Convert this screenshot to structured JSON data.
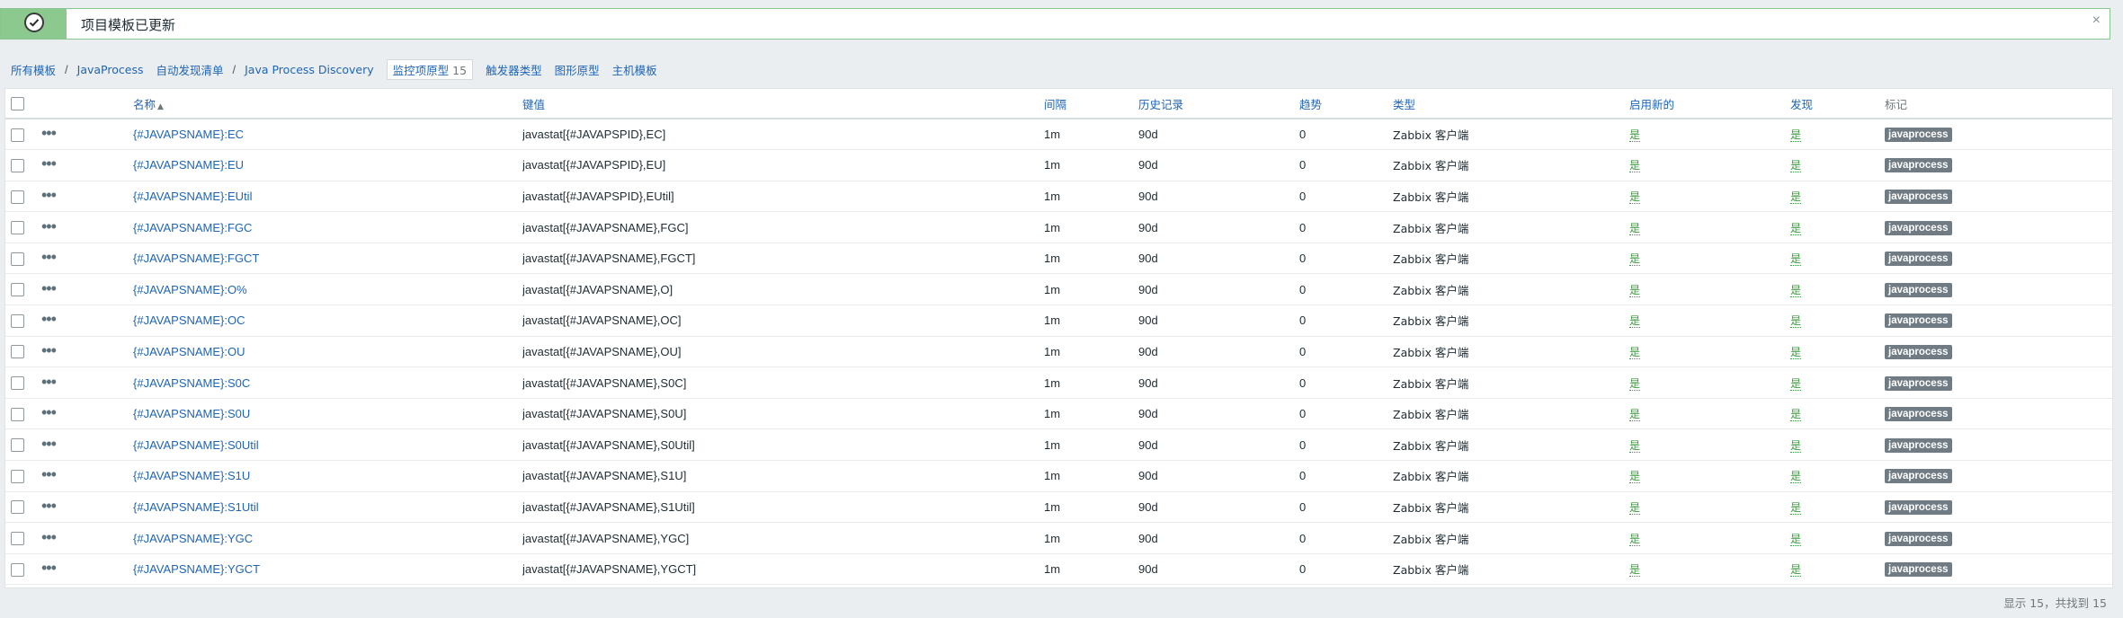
{
  "message": {
    "text": "项目模板已更新",
    "close": "×"
  },
  "nav": {
    "crumbs": [
      "所有模板",
      "JavaProcess",
      "自动发现清单",
      "Java Process Discovery"
    ],
    "separator": "/",
    "active_tab": "监控项原型",
    "active_count": "15",
    "tabs": [
      "触发器类型",
      "图形原型",
      "主机模板"
    ]
  },
  "table": {
    "headers": {
      "name": "名称",
      "sort_arrow": "▲",
      "key": "键值",
      "interval": "间隔",
      "history": "历史记录",
      "trends": "趋势",
      "type": "类型",
      "create_enabled": "启用新的",
      "discover": "发现",
      "tags": "标记"
    },
    "rows": [
      {
        "name": "{#JAVAPSNAME}:EC",
        "key": "javastat[{#JAVAPSPID},EC]",
        "interval": "1m",
        "history": "90d",
        "trends": "0",
        "type": "Zabbix 客户端",
        "create_enabled": "是",
        "discover": "是",
        "tag": "javaprocess"
      },
      {
        "name": "{#JAVAPSNAME}:EU",
        "key": "javastat[{#JAVAPSPID},EU]",
        "interval": "1m",
        "history": "90d",
        "trends": "0",
        "type": "Zabbix 客户端",
        "create_enabled": "是",
        "discover": "是",
        "tag": "javaprocess"
      },
      {
        "name": "{#JAVAPSNAME}:EUtil",
        "key": "javastat[{#JAVAPSPID},EUtil]",
        "interval": "1m",
        "history": "90d",
        "trends": "0",
        "type": "Zabbix 客户端",
        "create_enabled": "是",
        "discover": "是",
        "tag": "javaprocess"
      },
      {
        "name": "{#JAVAPSNAME}:FGC",
        "key": "javastat[{#JAVAPSNAME},FGC]",
        "interval": "1m",
        "history": "90d",
        "trends": "0",
        "type": "Zabbix 客户端",
        "create_enabled": "是",
        "discover": "是",
        "tag": "javaprocess"
      },
      {
        "name": "{#JAVAPSNAME}:FGCT",
        "key": "javastat[{#JAVAPSNAME},FGCT]",
        "interval": "1m",
        "history": "90d",
        "trends": "0",
        "type": "Zabbix 客户端",
        "create_enabled": "是",
        "discover": "是",
        "tag": "javaprocess"
      },
      {
        "name": "{#JAVAPSNAME}:O%",
        "key": "javastat[{#JAVAPSNAME},O]",
        "interval": "1m",
        "history": "90d",
        "trends": "0",
        "type": "Zabbix 客户端",
        "create_enabled": "是",
        "discover": "是",
        "tag": "javaprocess"
      },
      {
        "name": "{#JAVAPSNAME}:OC",
        "key": "javastat[{#JAVAPSNAME},OC]",
        "interval": "1m",
        "history": "90d",
        "trends": "0",
        "type": "Zabbix 客户端",
        "create_enabled": "是",
        "discover": "是",
        "tag": "javaprocess"
      },
      {
        "name": "{#JAVAPSNAME}:OU",
        "key": "javastat[{#JAVAPSNAME},OU]",
        "interval": "1m",
        "history": "90d",
        "trends": "0",
        "type": "Zabbix 客户端",
        "create_enabled": "是",
        "discover": "是",
        "tag": "javaprocess"
      },
      {
        "name": "{#JAVAPSNAME}:S0C",
        "key": "javastat[{#JAVAPSNAME},S0C]",
        "interval": "1m",
        "history": "90d",
        "trends": "0",
        "type": "Zabbix 客户端",
        "create_enabled": "是",
        "discover": "是",
        "tag": "javaprocess"
      },
      {
        "name": "{#JAVAPSNAME}:S0U",
        "key": "javastat[{#JAVAPSNAME},S0U]",
        "interval": "1m",
        "history": "90d",
        "trends": "0",
        "type": "Zabbix 客户端",
        "create_enabled": "是",
        "discover": "是",
        "tag": "javaprocess"
      },
      {
        "name": "{#JAVAPSNAME}:S0Util",
        "key": "javastat[{#JAVAPSNAME},S0Util]",
        "interval": "1m",
        "history": "90d",
        "trends": "0",
        "type": "Zabbix 客户端",
        "create_enabled": "是",
        "discover": "是",
        "tag": "javaprocess"
      },
      {
        "name": "{#JAVAPSNAME}:S1U",
        "key": "javastat[{#JAVAPSNAME},S1U]",
        "interval": "1m",
        "history": "90d",
        "trends": "0",
        "type": "Zabbix 客户端",
        "create_enabled": "是",
        "discover": "是",
        "tag": "javaprocess"
      },
      {
        "name": "{#JAVAPSNAME}:S1Util",
        "key": "javastat[{#JAVAPSNAME},S1Util]",
        "interval": "1m",
        "history": "90d",
        "trends": "0",
        "type": "Zabbix 客户端",
        "create_enabled": "是",
        "discover": "是",
        "tag": "javaprocess"
      },
      {
        "name": "{#JAVAPSNAME}:YGC",
        "key": "javastat[{#JAVAPSNAME},YGC]",
        "interval": "1m",
        "history": "90d",
        "trends": "0",
        "type": "Zabbix 客户端",
        "create_enabled": "是",
        "discover": "是",
        "tag": "javaprocess"
      },
      {
        "name": "{#JAVAPSNAME}:YGCT",
        "key": "javastat[{#JAVAPSNAME},YGCT]",
        "interval": "1m",
        "history": "90d",
        "trends": "0",
        "type": "Zabbix 客户端",
        "create_enabled": "是",
        "discover": "是",
        "tag": "javaprocess"
      }
    ]
  },
  "footer": {
    "text": "显示 15，共找到 15"
  }
}
